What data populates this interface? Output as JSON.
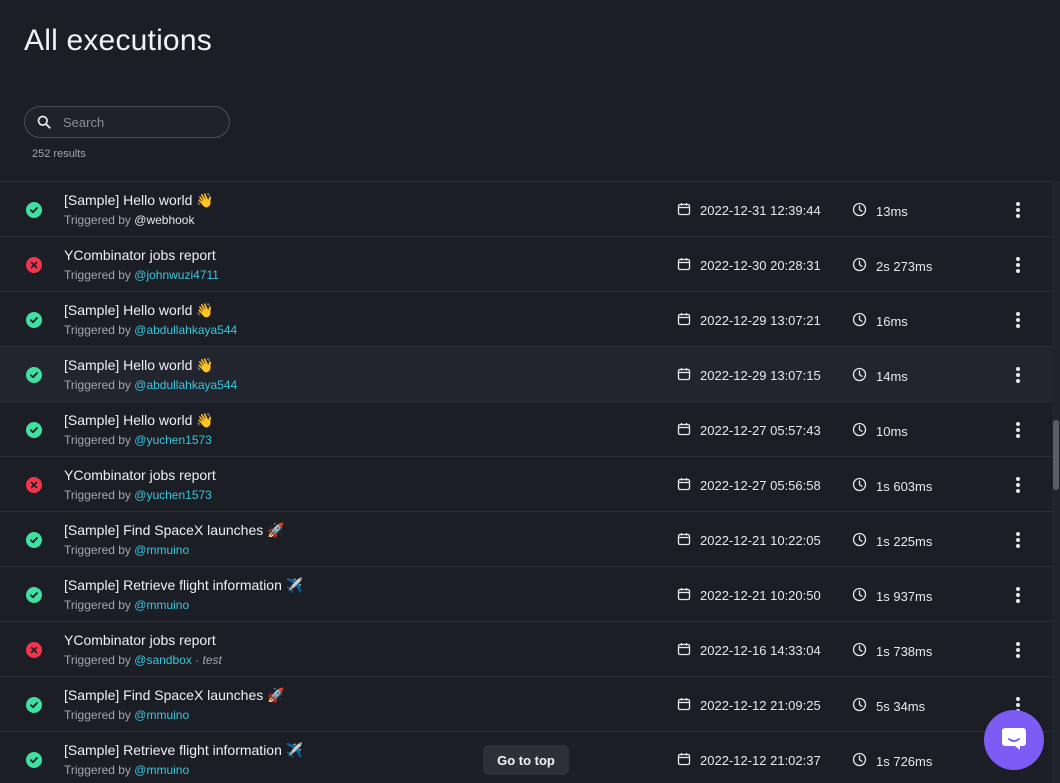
{
  "page": {
    "title": "All executions"
  },
  "search": {
    "placeholder": "Search",
    "results_text": "252 results"
  },
  "triggered_by_label": "Triggered by",
  "executions": [
    {
      "status": "success",
      "name": "[Sample] Hello world 👋",
      "user": "@webhook",
      "user_style": "plain",
      "date": "2022-12-31 12:39:44",
      "duration": "13ms"
    },
    {
      "status": "error",
      "name": "YCombinator jobs report",
      "user": "@johnwuzi4711",
      "user_style": "link",
      "date": "2022-12-30 20:28:31",
      "duration": "2s 273ms"
    },
    {
      "status": "success",
      "name": "[Sample] Hello world 👋",
      "user": "@abdullahkaya544",
      "user_style": "link",
      "date": "2022-12-29 13:07:21",
      "duration": "16ms"
    },
    {
      "status": "success",
      "name": "[Sample] Hello world 👋",
      "user": "@abdullahkaya544",
      "user_style": "link",
      "date": "2022-12-29 13:07:15",
      "duration": "14ms",
      "highlighted": true
    },
    {
      "status": "success",
      "name": "[Sample] Hello world 👋",
      "user": "@yuchen1573",
      "user_style": "link",
      "date": "2022-12-27 05:57:43",
      "duration": "10ms"
    },
    {
      "status": "error",
      "name": "YCombinator jobs report",
      "user": "@yuchen1573",
      "user_style": "link",
      "date": "2022-12-27 05:56:58",
      "duration": "1s 603ms"
    },
    {
      "status": "success",
      "name": "[Sample] Find SpaceX launches 🚀",
      "user": "@mmuino",
      "user_style": "link",
      "date": "2022-12-21 10:22:05",
      "duration": "1s 225ms"
    },
    {
      "status": "success",
      "name": "[Sample] Retrieve flight information ✈️",
      "user": "@mmuino",
      "user_style": "link",
      "date": "2022-12-21 10:20:50",
      "duration": "1s 937ms"
    },
    {
      "status": "error",
      "name": "YCombinator jobs report",
      "user": "@sandbox",
      "user_style": "link",
      "tag": "test",
      "date": "2022-12-16 14:33:04",
      "duration": "1s 738ms"
    },
    {
      "status": "success",
      "name": "[Sample] Find SpaceX launches 🚀",
      "user": "@mmuino",
      "user_style": "link",
      "date": "2022-12-12 21:09:25",
      "duration": "5s 34ms"
    },
    {
      "status": "success",
      "name": "[Sample] Retrieve flight information ✈️",
      "user": "@mmuino",
      "user_style": "link",
      "date": "2022-12-12 21:02:37",
      "duration": "1s 726ms"
    }
  ],
  "go_to_top_label": "Go to top",
  "colors": {
    "background": "#1c1e25",
    "success": "#3fe0a0",
    "error": "#f0364c",
    "link": "#38c6dc",
    "chat": "#7c5cf5"
  },
  "icons": {
    "search": "search-icon",
    "calendar": "calendar-icon",
    "clock": "clock-icon",
    "more": "more-vertical-icon",
    "chat": "chat-icon"
  }
}
